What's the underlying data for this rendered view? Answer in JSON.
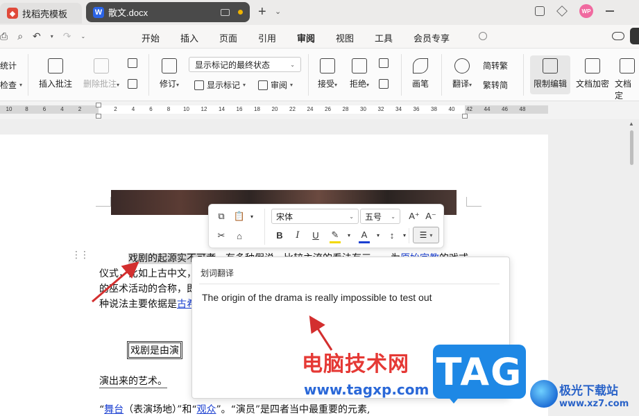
{
  "tabs": {
    "home": {
      "label": "找稻壳模板",
      "icon": "docer-logo-icon"
    },
    "doc": {
      "label": "散文.docx",
      "badge": "W",
      "icon": "wps-writer-icon"
    }
  },
  "window": {
    "avatar": "WP"
  },
  "menu": {
    "items": [
      "开始",
      "插入",
      "页面",
      "引用",
      "审阅",
      "视图",
      "工具",
      "会员专享"
    ],
    "active": "审阅"
  },
  "ribbon": {
    "edge_top": "统计",
    "edge_bottom": "检查",
    "insert_comment": "插入批注",
    "delete_comment": "删除批注",
    "revise": "修订",
    "markup_dropdown": "显示标记的最终状态",
    "show_markup": "显示标记",
    "review": "审阅",
    "accept": "接受",
    "reject": "拒绝",
    "pen": "画笔",
    "translate": "翻译",
    "to_traditional": "简转繁",
    "to_simplified": "繁转简",
    "restrict_edit": "限制编辑",
    "encrypt": "文档加密",
    "doc_final": "文档定"
  },
  "ruler": {
    "ticks": [
      "10",
      "8",
      "6",
      "4",
      "2",
      "2",
      "4",
      "6",
      "8",
      "10",
      "12",
      "14",
      "16",
      "18",
      "20",
      "22",
      "24",
      "26",
      "28",
      "30",
      "32",
      "34",
      "36",
      "38",
      "40",
      "42",
      "44",
      "46",
      "48"
    ]
  },
  "document": {
    "para1_highlight": "戏剧的起源实不可考",
    "para1_rest": "，有多种假说，比较主流的看法有三——为",
    "para1_link": "原始宗教",
    "para1_end": "的戏式",
    "line2": "仪式，比如上古中文，",
    "line3": "的巫术活动的合称，即",
    "line4": "种说法主要依据是",
    "line4_link": "古希",
    "boxed": "戏剧是由演",
    "line6": "演出来的艺术。",
    "line6_tail": "ー",
    "line7_q1": "“",
    "line7_link1": "舞台",
    "line7_mid1": "（表演场地）”和“",
    "line7_link2": "观众",
    "line7_mid2": "”。“演员”是四者当中最重要的元素,"
  },
  "format_toolbar": {
    "font": "宋体",
    "size": "五号",
    "grow": "A⁺",
    "shrink": "A⁻",
    "bold": "B",
    "italic": "I",
    "underline": "U",
    "highlight_color": "#f2d800",
    "font_color": "#1a3fd1"
  },
  "translate_popup": {
    "title": "划词翻译",
    "result": "The origin of the drama is really impossible to test out"
  },
  "watermarks": {
    "cn": "电脑技术网",
    "url": "www.tagxp.com",
    "tag": "TAG",
    "site_name": "极光下载站",
    "site_url": "www.xz7.com"
  }
}
